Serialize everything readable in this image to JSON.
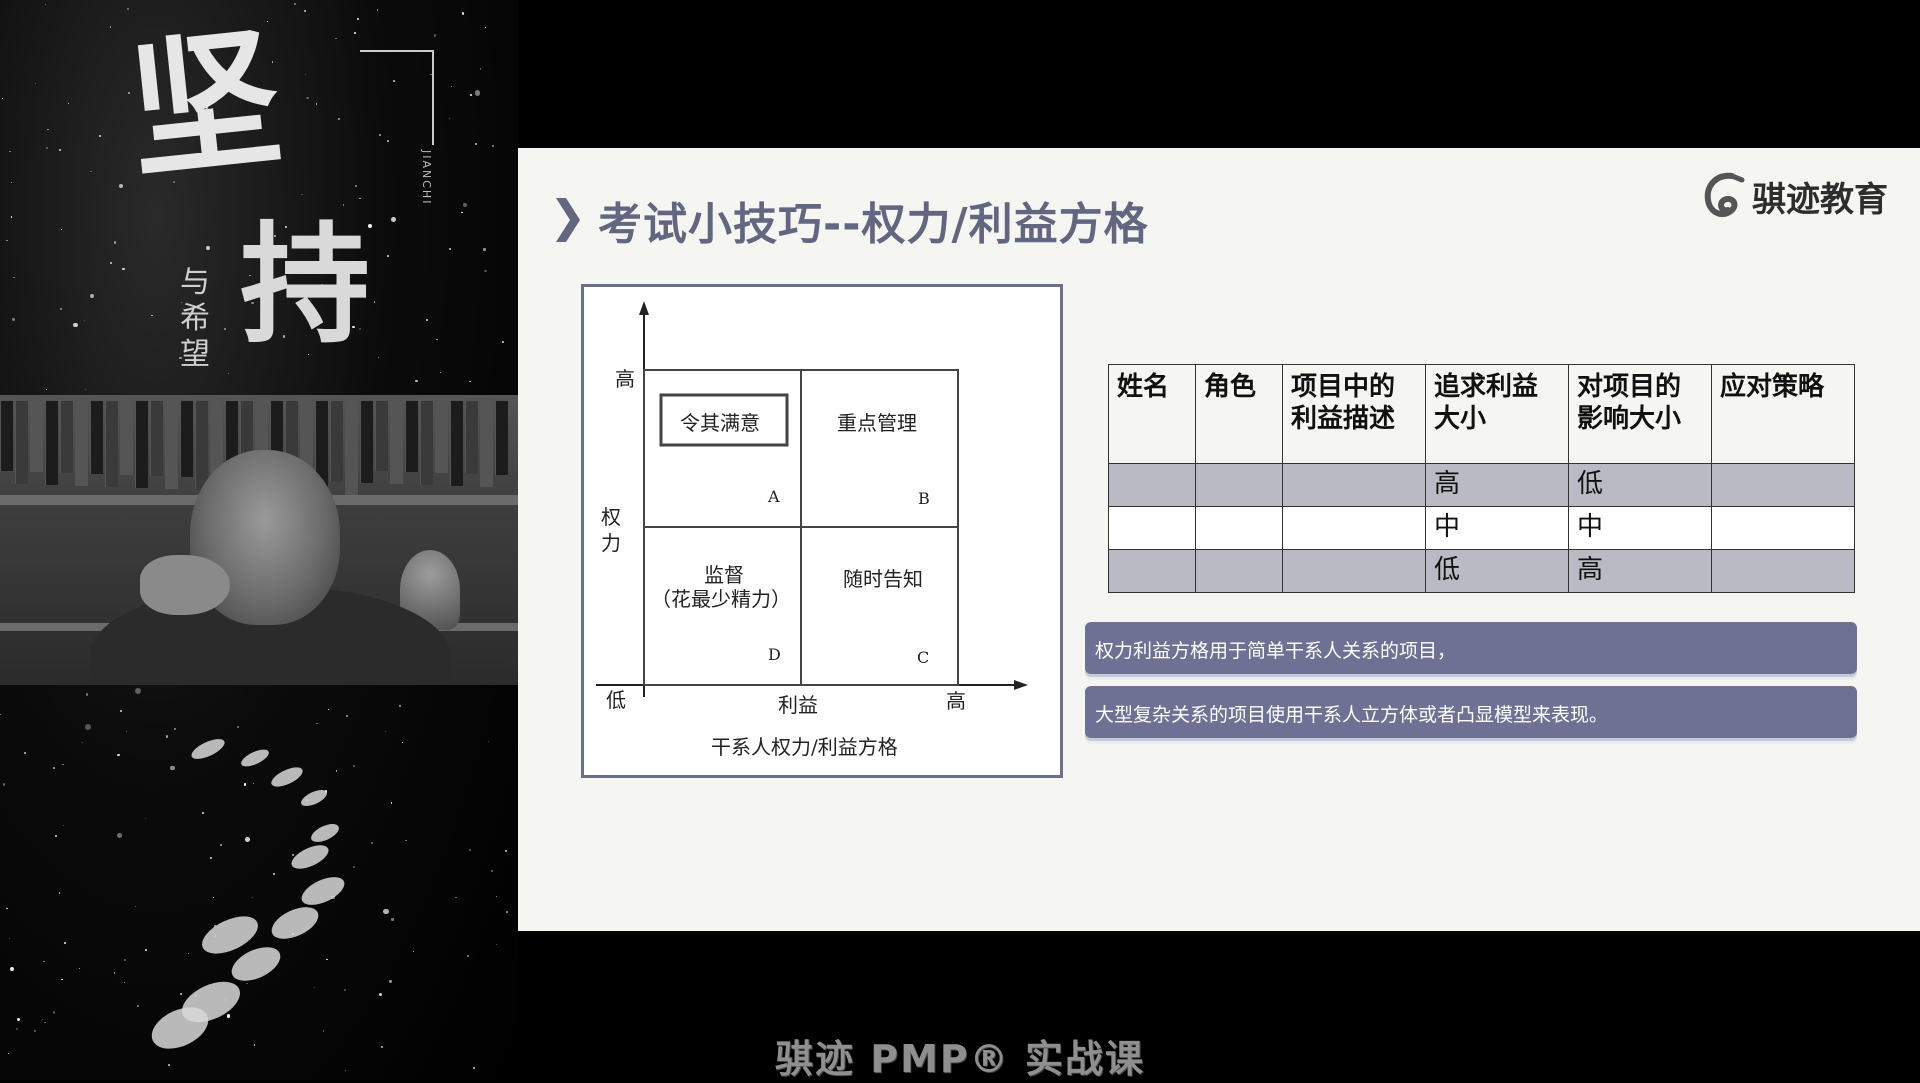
{
  "poster": {
    "title_char_1": "坚",
    "title_char_2": "持",
    "subtitle": "与希望",
    "pinyin": "JIANCHI"
  },
  "slide": {
    "title": "考试小技巧--权力/利益方格",
    "brand": "骐迹教育",
    "grid": {
      "y_high": "高",
      "y_low": "低",
      "y_axis_label": "权力",
      "x_axis_label": "利益",
      "x_high": "高",
      "caption": "干系人权力/利益方格",
      "quadrants": [
        {
          "id": "A",
          "text": "令其满意"
        },
        {
          "id": "B",
          "text": "重点管理"
        },
        {
          "id": "D",
          "text_line1": "监督",
          "text_line2": "（花最少精力）"
        },
        {
          "id": "C",
          "text": "随时告知"
        }
      ]
    },
    "table": {
      "headers": [
        "姓名",
        "角色",
        "项目中的利益描述",
        "追求利益大小",
        "对项目的影响大小",
        "应对策略"
      ],
      "header_lines": [
        [
          "姓名"
        ],
        [
          "角色"
        ],
        [
          "项目中的",
          "利益描述"
        ],
        [
          "追求利益",
          "大小"
        ],
        [
          "对项目的",
          "影响大小"
        ],
        [
          "应对策略"
        ]
      ],
      "rows": [
        [
          "",
          "",
          "",
          "高",
          "低",
          ""
        ],
        [
          "",
          "",
          "",
          "中",
          "中",
          ""
        ],
        [
          "",
          "",
          "",
          "低",
          "高",
          ""
        ]
      ]
    },
    "notes": [
      "权力利益方格用于简单干系人关系的项目，",
      "大型复杂关系的项目使用干系人立方体或者凸显模型来表现。"
    ]
  },
  "caption": "骐迹 PMP® 实战课",
  "colors": {
    "accent": "#636680",
    "band": "#6e7193",
    "row_shade": "#b9bac4"
  }
}
